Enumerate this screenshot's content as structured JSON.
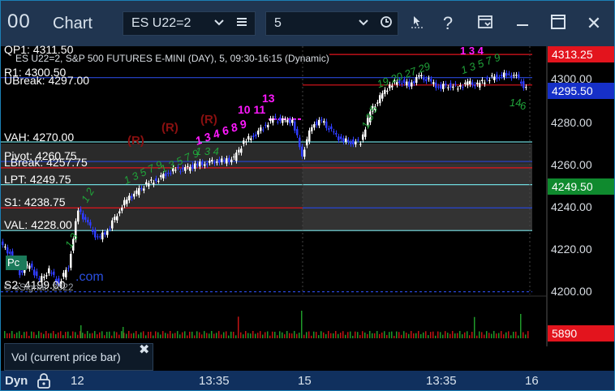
{
  "titlebar": {
    "logo_text": "00",
    "title": "Chart",
    "symbol_select": "ES U22=2",
    "interval_select": "5",
    "icons": [
      "chevron-down-icon",
      "list-icon",
      "chevron-down-icon",
      "clock-icon",
      "cursor-icon",
      "help-icon",
      "display-icon",
      "minimize-icon",
      "maximize-icon",
      "close-icon"
    ],
    "help_glyph": "?",
    "close_glyph": "✕"
  },
  "chart": {
    "header": "ES U22=2, S&P 500 FUTURES E-MINI (DAY), 5, 09:30-16:15 (Dynamic)",
    "levels": [
      {
        "id": "qp1",
        "label": "QP1: 4311.50",
        "price": 4311.5
      },
      {
        "id": "r1",
        "label": "R1: 4300.50",
        "price": 4300.5
      },
      {
        "id": "ubreak",
        "label": "UBreak: 4297.00",
        "price": 4297.0
      },
      {
        "id": "vah",
        "label": "VAH: 4270.00",
        "price": 4270.0
      },
      {
        "id": "pivot",
        "label": "Pivot: 4260.75",
        "price": 4260.75
      },
      {
        "id": "lbreak",
        "label": "LBreak: 4257.75",
        "price": 4257.75
      },
      {
        "id": "lpt",
        "label": "LPT: 4249.75",
        "price": 4249.75
      },
      {
        "id": "s1",
        "label": "S1: 4238.75",
        "price": 4238.75
      },
      {
        "id": "val",
        "label": "VAL: 4228.00",
        "price": 4228.0
      },
      {
        "id": "s2",
        "label": "S2: 4199.00",
        "price": 4199.0
      }
    ],
    "price_axis": [
      "4300.00",
      "4280.00",
      "4260.00",
      "4240.00",
      "4220.00",
      "4200.00"
    ],
    "price_tags": [
      {
        "label": "4313.25",
        "color": "#e3141d"
      },
      {
        "label": "4295.50",
        "color": "#1630c8"
      },
      {
        "label": "4249.50",
        "color": "#0f8a2e"
      },
      {
        "label": "5890",
        "color": "#e3141d"
      }
    ],
    "annotations": {
      "r_marks": [
        "(R)",
        "(R)",
        "(R)"
      ],
      "magenta_counts": [
        "1 3 4 6 8 9",
        "10 11",
        "13",
        "1 3 4"
      ],
      "green_counts": [
        "1 3 5 7 9",
        "1 3 5 7 9",
        "1 3 4",
        "19 20 27 29",
        "1 3 5 7 9",
        "1 2",
        "1 3",
        "1 3 5",
        "14",
        "6"
      ],
      "pc_badge": "Pc",
      "watermark": ".com",
      "copyright": "© eSignal, 2022"
    },
    "volume_label": "Vol (current price bar)",
    "volume_close_glyph": "✖"
  },
  "bottombar": {
    "dyn_label": "Dyn",
    "time_labels": [
      "12",
      "13:35",
      "15",
      "13:35",
      "16"
    ]
  },
  "colors": {
    "titlebar": "#203550",
    "bottombar": "#10305e",
    "up_candle": "#ffffff",
    "down_candle": "#2f3cff",
    "level_red": "#e3141d",
    "level_blue": "#2846d6",
    "level_cyan": "#6fd9dd",
    "magenta": "#ff19ff",
    "green_count": "#20a33a"
  }
}
